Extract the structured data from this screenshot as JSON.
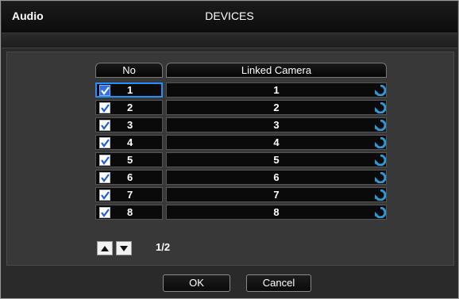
{
  "window": {
    "title": "DEVICES",
    "tab": "Audio"
  },
  "table": {
    "headers": {
      "no": "No",
      "camera": "Linked Camera"
    },
    "rows": [
      {
        "no": "1",
        "camera": "1",
        "checked": true,
        "focused": true
      },
      {
        "no": "2",
        "camera": "2",
        "checked": true,
        "focused": false
      },
      {
        "no": "3",
        "camera": "3",
        "checked": true,
        "focused": false
      },
      {
        "no": "4",
        "camera": "4",
        "checked": true,
        "focused": false
      },
      {
        "no": "5",
        "camera": "5",
        "checked": true,
        "focused": false
      },
      {
        "no": "6",
        "camera": "6",
        "checked": true,
        "focused": false
      },
      {
        "no": "7",
        "camera": "7",
        "checked": true,
        "focused": false
      },
      {
        "no": "8",
        "camera": "8",
        "checked": true,
        "focused": false
      }
    ]
  },
  "pager": {
    "page": "1/2"
  },
  "buttons": {
    "ok": "OK",
    "cancel": "Cancel"
  },
  "colors": {
    "focus": "#1e90ff",
    "refresh_icon": "#2a9bd8"
  },
  "icons": {
    "row_action": "refresh-icon",
    "page_up": "triangle-up-icon",
    "page_down": "triangle-down-icon"
  }
}
